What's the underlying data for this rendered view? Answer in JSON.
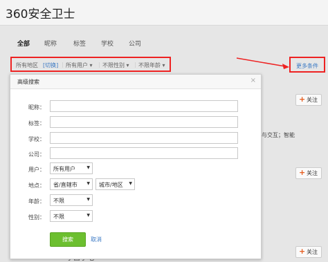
{
  "search": {
    "query": "360安全卫士"
  },
  "tabs": [
    "全部",
    "昵称",
    "标签",
    "学校",
    "公司"
  ],
  "filters": {
    "all_regions": "所有地区",
    "switch": "[切换]",
    "all_users": "所有用户",
    "gender": "不限性别",
    "age": "不限年龄",
    "more": "更多条件"
  },
  "feed": {
    "follow_label": "关注",
    "snippet": "与交互；智能",
    "bottom_name": "小吕小吃"
  },
  "dialog": {
    "title": "高级搜索",
    "close": "×",
    "labels": {
      "nickname": "昵称：",
      "tag": "标签：",
      "school": "学校：",
      "company": "公司：",
      "user": "用户：",
      "location": "地点：",
      "age": "年龄：",
      "gender": "性别："
    },
    "user_select": "所有用户",
    "province_select": "省/直辖市",
    "city_select": "城市/地区",
    "age_select": "不限",
    "gender_select": "不限",
    "search_button": "搜索",
    "cancel_link": "取消"
  },
  "colors": {
    "highlight": "#ee2222",
    "link": "#3a79c4",
    "primary_button": "#6cbf2f"
  }
}
